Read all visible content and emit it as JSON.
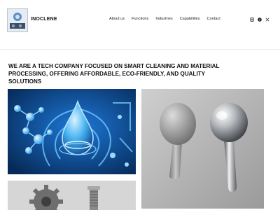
{
  "header": {
    "brand": "INOCLENE",
    "nav": [
      "About us",
      "Functions",
      "Industries",
      "Capabilities",
      "Contact"
    ],
    "social_icons": [
      "instagram-icon",
      "facebook-icon",
      "x-icon"
    ]
  },
  "hero": {
    "headline": "WE ARE A TECH COMPANY FOCUSED ON SMART CLEANING AND MATERIAL PROCESSING, OFFERING AFFORDABLE, ECO-FRIENDLY, AND QUALITY SOLUTIONS"
  },
  "gallery": {
    "images": [
      "water-droplet-molecule-image",
      "metal-parts-image",
      "gear-and-bolt-image"
    ]
  },
  "colors": {
    "accent_blue": "#1a6fd1",
    "text": "#111111"
  }
}
